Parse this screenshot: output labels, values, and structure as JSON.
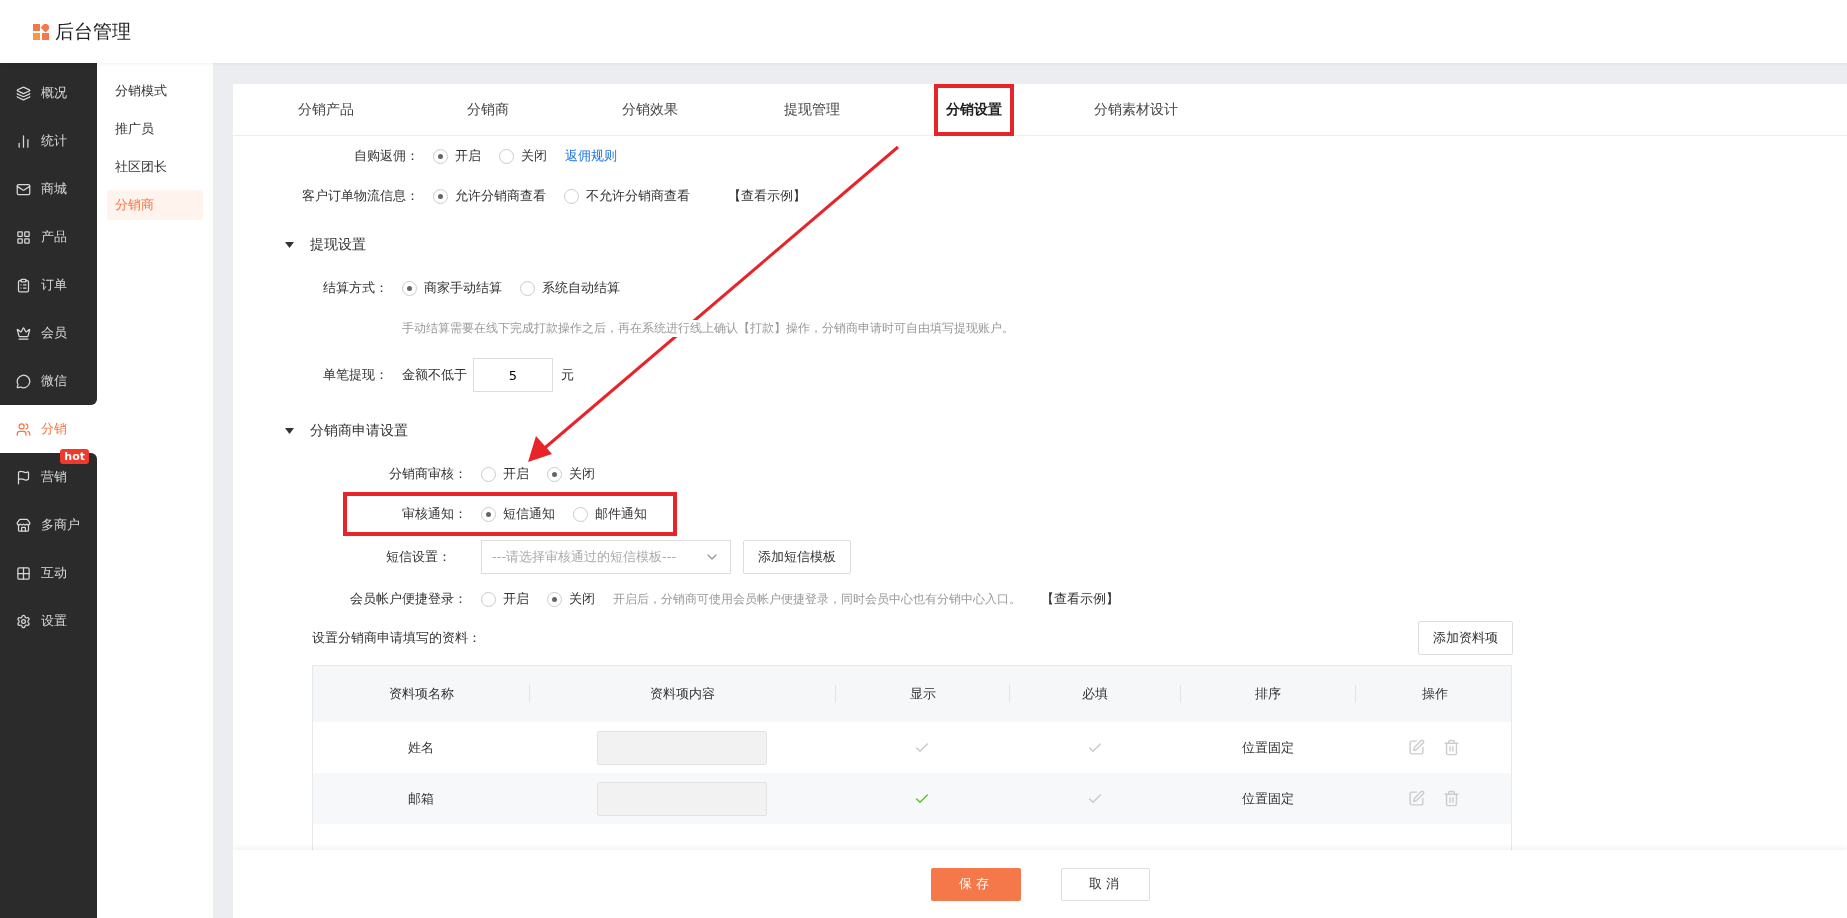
{
  "header": {
    "title": "后台管理"
  },
  "sidebar": {
    "items": [
      {
        "label": "概况",
        "selected": false
      },
      {
        "label": "统计",
        "selected": false
      },
      {
        "label": "商城",
        "selected": false
      },
      {
        "label": "产品",
        "selected": false
      },
      {
        "label": "订单",
        "selected": false
      },
      {
        "label": "会员",
        "selected": false
      },
      {
        "label": "微信",
        "selected": false
      },
      {
        "label": "分销",
        "selected": true
      },
      {
        "label": "营销",
        "selected": false,
        "badge": "hot"
      },
      {
        "label": "多商户",
        "selected": false
      },
      {
        "label": "互动",
        "selected": false
      },
      {
        "label": "设置",
        "selected": false
      }
    ]
  },
  "subnav": {
    "items": [
      {
        "label": "分销模式",
        "selected": false
      },
      {
        "label": "推广员",
        "selected": false
      },
      {
        "label": "社区团长",
        "selected": false
      },
      {
        "label": "分销商",
        "selected": true
      }
    ]
  },
  "tabs": [
    {
      "label": "分销产品",
      "selected": false,
      "highlighted": false
    },
    {
      "label": "分销商",
      "selected": false,
      "highlighted": false
    },
    {
      "label": "分销效果",
      "selected": false,
      "highlighted": false
    },
    {
      "label": "提现管理",
      "selected": false,
      "highlighted": false
    },
    {
      "label": "分销设置",
      "selected": true,
      "highlighted": true
    },
    {
      "label": "分销素材设计",
      "selected": false,
      "highlighted": false
    }
  ],
  "top_rows": [
    {
      "kind": "radio",
      "label": "自购返佣：",
      "options": [
        {
          "label": "开启",
          "selected": true
        },
        {
          "label": "关闭",
          "selected": false
        }
      ],
      "link": "返佣规则",
      "highlighted": false
    },
    {
      "kind": "radio",
      "label": "客户订单物流信息：",
      "options": [
        {
          "label": "允许分销商查看",
          "selected": true
        },
        {
          "label": "不允许分销商查看",
          "selected": false
        }
      ],
      "example": "【查看示例】",
      "highlighted": false
    }
  ],
  "sections": [
    {
      "title": "提现设置",
      "expanded": true,
      "rows": [
        {
          "kind": "radio",
          "label": "结算方式：",
          "options": [
            {
              "label": "商家手动结算",
              "selected": true
            },
            {
              "label": "系统自动结算",
              "selected": false
            }
          ],
          "highlighted": false
        },
        {
          "kind": "note",
          "text": "手动结算需要在线下完成打款操作之后，再在系统进行线上确认【打款】操作，分销商申请时可自由填写提现账户。"
        },
        {
          "kind": "amount",
          "label": "单笔提现：",
          "prefix": "金额不低于",
          "value": "5",
          "suffix": "元"
        }
      ]
    },
    {
      "title": "分销商申请设置",
      "expanded": true,
      "rows": [
        {
          "kind": "radio",
          "label": "分销商审核：",
          "options": [
            {
              "label": "开启",
              "selected": false
            },
            {
              "label": "关闭",
              "selected": true
            }
          ],
          "highlighted": false
        },
        {
          "kind": "radio",
          "label": "审核通知：",
          "options": [
            {
              "label": "短信通知",
              "selected": true
            },
            {
              "label": "邮件通知",
              "selected": false
            }
          ],
          "highlighted": true
        },
        {
          "kind": "select",
          "label": "短信设置：",
          "placeholder": "---请选择审核通过的短信模板---",
          "button": "添加短信模板"
        },
        {
          "kind": "radio",
          "label": "会员帐户便捷登录：",
          "options": [
            {
              "label": "开启",
              "selected": false
            },
            {
              "label": "关闭",
              "selected": true
            }
          ],
          "hint": "开启后，分销商可使用会员帐户便捷登录，同时会员中心也有分销中心入口。",
          "example": "【查看示例】",
          "highlighted": false
        }
      ]
    }
  ],
  "fields": {
    "title": "设置分销商申请填写的资料：",
    "add_button": "添加资料项",
    "columns": [
      "资料项名称",
      "资料项内容",
      "显示",
      "必填",
      "排序",
      "操作"
    ],
    "rows": [
      {
        "name": "姓名",
        "show": false,
        "required": false,
        "order": "位置固定"
      },
      {
        "name": "邮箱",
        "show": true,
        "required": false,
        "order": "位置固定"
      }
    ]
  },
  "footer": {
    "save": "保存",
    "cancel": "取消"
  }
}
